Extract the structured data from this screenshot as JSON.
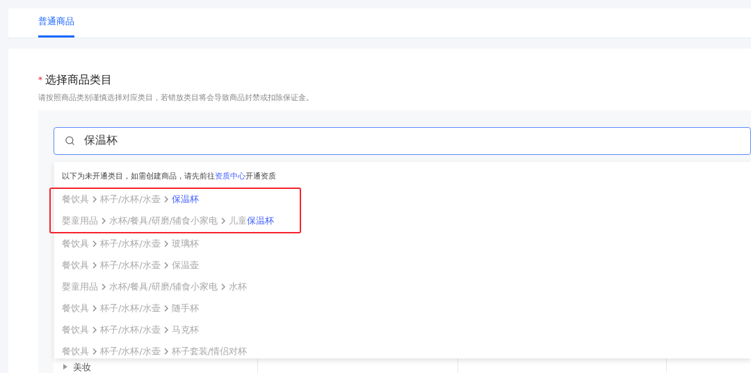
{
  "tabs": [
    {
      "label": "普通商品",
      "selected": true
    }
  ],
  "section": {
    "required_mark": "*",
    "title": "选择商品类目",
    "description": "请按照商品类别谨慎选择对应类目，若错放类目将会导致商品封禁或扣除保证金。"
  },
  "search": {
    "value": "保温杯"
  },
  "dropdown": {
    "notice": {
      "before": "以下为未开通类目，如需创建商品，请先前往",
      "link": "资质中心",
      "after": "开通资质"
    },
    "results": [
      {
        "boxed": true,
        "path": [
          "餐饮具",
          "杯子/水杯/水壶"
        ],
        "leaf": [
          {
            "text": "保温杯",
            "match": true
          }
        ]
      },
      {
        "boxed": true,
        "path": [
          "婴童用品",
          "水杯/餐具/研磨/辅食小家电"
        ],
        "leaf": [
          {
            "text": "儿童",
            "match": false
          },
          {
            "text": "保温杯",
            "match": true
          }
        ]
      },
      {
        "boxed": false,
        "path": [
          "餐饮具",
          "杯子/水杯/水壶"
        ],
        "leaf": [
          {
            "text": "玻璃杯",
            "match": false
          }
        ]
      },
      {
        "boxed": false,
        "path": [
          "餐饮具",
          "杯子/水杯/水壶"
        ],
        "leaf": [
          {
            "text": "保温壶",
            "match": false
          }
        ]
      },
      {
        "boxed": false,
        "path": [
          "婴童用品",
          "水杯/餐具/研磨/辅食小家电"
        ],
        "leaf": [
          {
            "text": "水杯",
            "match": false
          }
        ]
      },
      {
        "boxed": false,
        "path": [
          "餐饮具",
          "杯子/水杯/水壶"
        ],
        "leaf": [
          {
            "text": "随手杯",
            "match": false
          }
        ]
      },
      {
        "boxed": false,
        "path": [
          "餐饮具",
          "杯子/水杯/水壶"
        ],
        "leaf": [
          {
            "text": "马克杯",
            "match": false
          }
        ]
      },
      {
        "boxed": false,
        "path": [
          "餐饮具",
          "杯子/水杯/水壶"
        ],
        "leaf": [
          {
            "text": "杯子套装/情侣对杯",
            "match": false
          }
        ]
      }
    ]
  },
  "category_tree": [
    {
      "label": "美妆",
      "expanded": false
    }
  ]
}
